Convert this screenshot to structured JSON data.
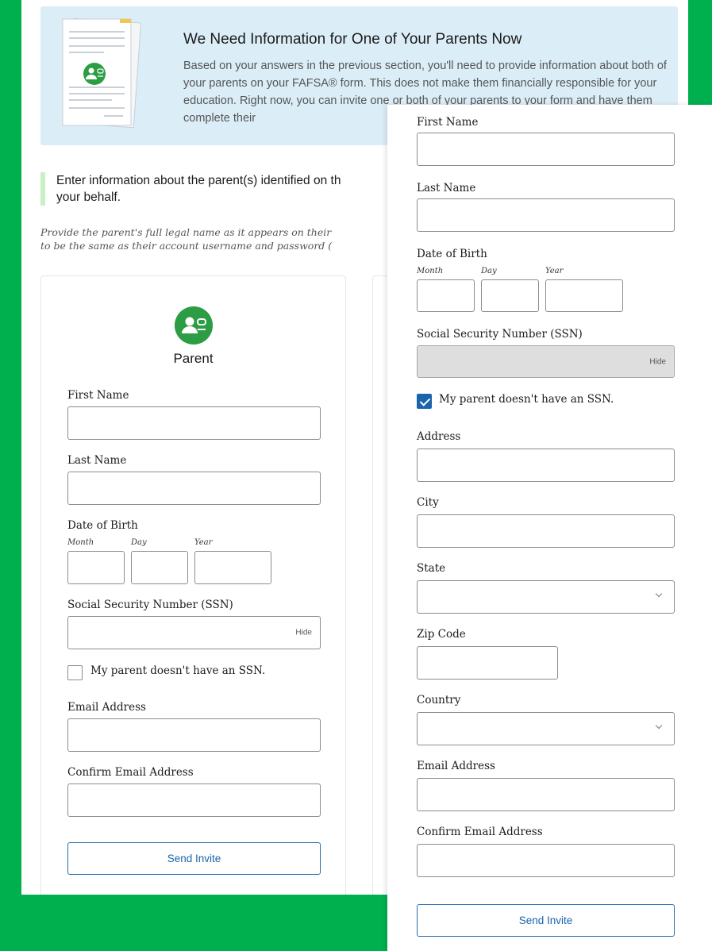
{
  "banner": {
    "title": "We Need Information for One of Your Parents Now",
    "text": "Based on your answers in the previous section, you'll need to provide information about both of your parents on your FAFSA® form. This does not make them financially responsible for your education. Right now, you can invite one or both of your parents to your form and have them complete their"
  },
  "callout": {
    "line1": "Enter information about the parent(s) identified on th",
    "line2": "your behalf."
  },
  "instruction": {
    "line1": "Provide the parent's full legal name as it appears on their",
    "line2": "to be the same as their account username and password ("
  },
  "card": {
    "title": "Parent",
    "first_name_label": "First Name",
    "last_name_label": "Last Name",
    "dob_label": "Date of Birth",
    "month_label": "Month",
    "day_label": "Day",
    "year_label": "Year",
    "ssn_label": "Social Security Number (SSN)",
    "hide_label": "Hide",
    "no_ssn_label": "My parent doesn't have an SSN.",
    "no_ssn_checked": false,
    "email_label": "Email Address",
    "confirm_email_label": "Confirm Email Address",
    "send_invite": "Send Invite"
  },
  "overlay": {
    "first_name_label": "First Name",
    "last_name_label": "Last Name",
    "dob_label": "Date of Birth",
    "month_label": "Month",
    "day_label": "Day",
    "year_label": "Year",
    "ssn_label": "Social Security Number (SSN)",
    "hide_label": "Hide",
    "no_ssn_label": "My parent doesn't have an SSN.",
    "no_ssn_checked": true,
    "address_label": "Address",
    "city_label": "City",
    "state_label": "State",
    "zip_label": "Zip Code",
    "country_label": "Country",
    "email_label": "Email Address",
    "confirm_email_label": "Confirm Email Address",
    "send_invite": "Send Invite"
  },
  "colors": {
    "background_green": "#00b04f",
    "banner_blue": "#dbeef8",
    "badge_green": "#2c9d44",
    "checkbox_blue": "#1a64ad",
    "callout_bar": "#c9f0c5"
  },
  "icons": {
    "banner": "form-document-icon",
    "badge": "parent-user-icon",
    "select": "chevron-down-icon"
  }
}
